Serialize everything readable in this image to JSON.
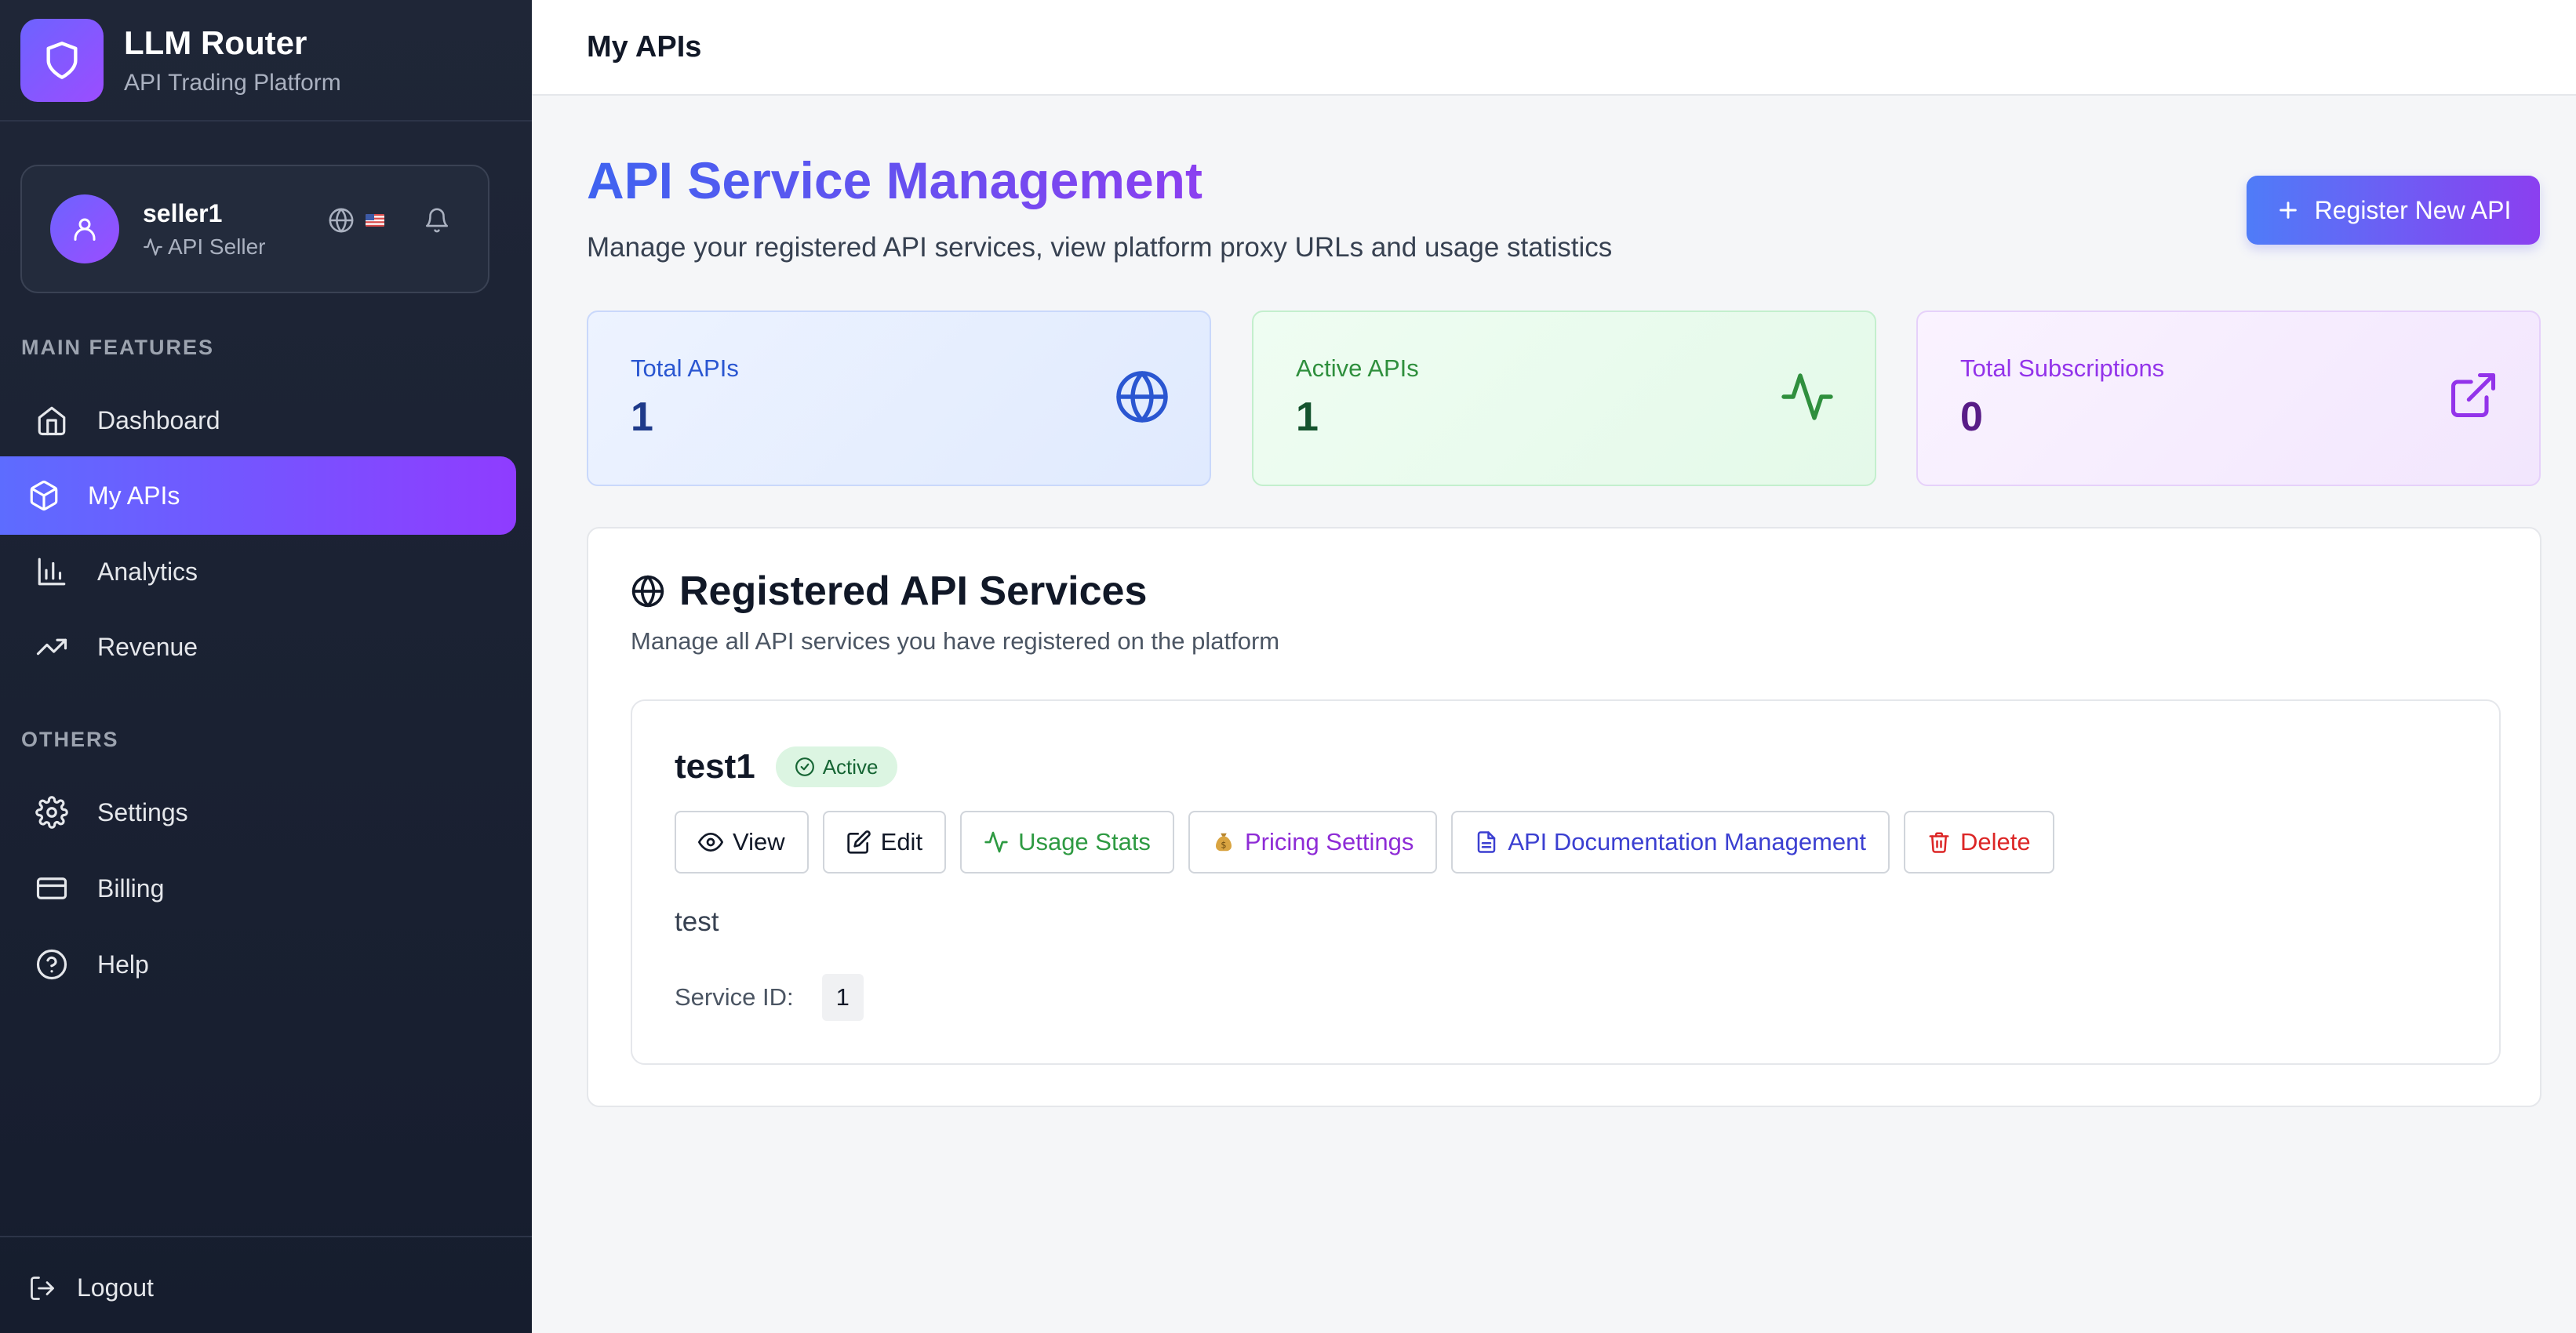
{
  "brand": {
    "title": "LLM Router",
    "subtitle": "API Trading Platform",
    "logo_icon": "shield-icon",
    "accent": "#7b5cff"
  },
  "user": {
    "name": "seller1",
    "role": "API Seller",
    "language_flag": "us-flag"
  },
  "sidebar": {
    "section_main": "MAIN FEATURES",
    "section_others": "OTHERS",
    "main_items": [
      {
        "label": "Dashboard",
        "icon": "home-icon"
      },
      {
        "label": "My APIs",
        "icon": "box-icon",
        "active": true
      },
      {
        "label": "Analytics",
        "icon": "bar-chart-icon"
      },
      {
        "label": "Revenue",
        "icon": "trending-up-icon"
      }
    ],
    "other_items": [
      {
        "label": "Settings",
        "icon": "gear-icon"
      },
      {
        "label": "Billing",
        "icon": "credit-card-icon"
      },
      {
        "label": "Help",
        "icon": "help-circle-icon"
      }
    ],
    "logout": "Logout"
  },
  "header": {
    "title": "My APIs"
  },
  "main": {
    "title": "API Service Management",
    "subtitle": "Manage your registered API services, view platform proxy URLs and usage statistics",
    "register_button": "Register New API",
    "stats": [
      {
        "label": "Total APIs",
        "value": "1",
        "icon": "globe-icon",
        "color": "#2a56d1"
      },
      {
        "label": "Active APIs",
        "value": "1",
        "icon": "activity-icon",
        "color": "#2f8f3d"
      },
      {
        "label": "Total Subscriptions",
        "value": "0",
        "icon": "external-link-icon",
        "color": "#9333ea"
      }
    ],
    "panel": {
      "title": "Registered API Services",
      "subtitle": "Manage all API services you have registered on the platform"
    },
    "service": {
      "name": "test1",
      "status": "Active",
      "description": "test",
      "id_label": "Service ID:",
      "id_value": "1",
      "actions": {
        "view": "View",
        "edit": "Edit",
        "usage": "Usage Stats",
        "pricing": "Pricing Settings",
        "docs": "API Documentation Management",
        "delete": "Delete"
      }
    }
  }
}
